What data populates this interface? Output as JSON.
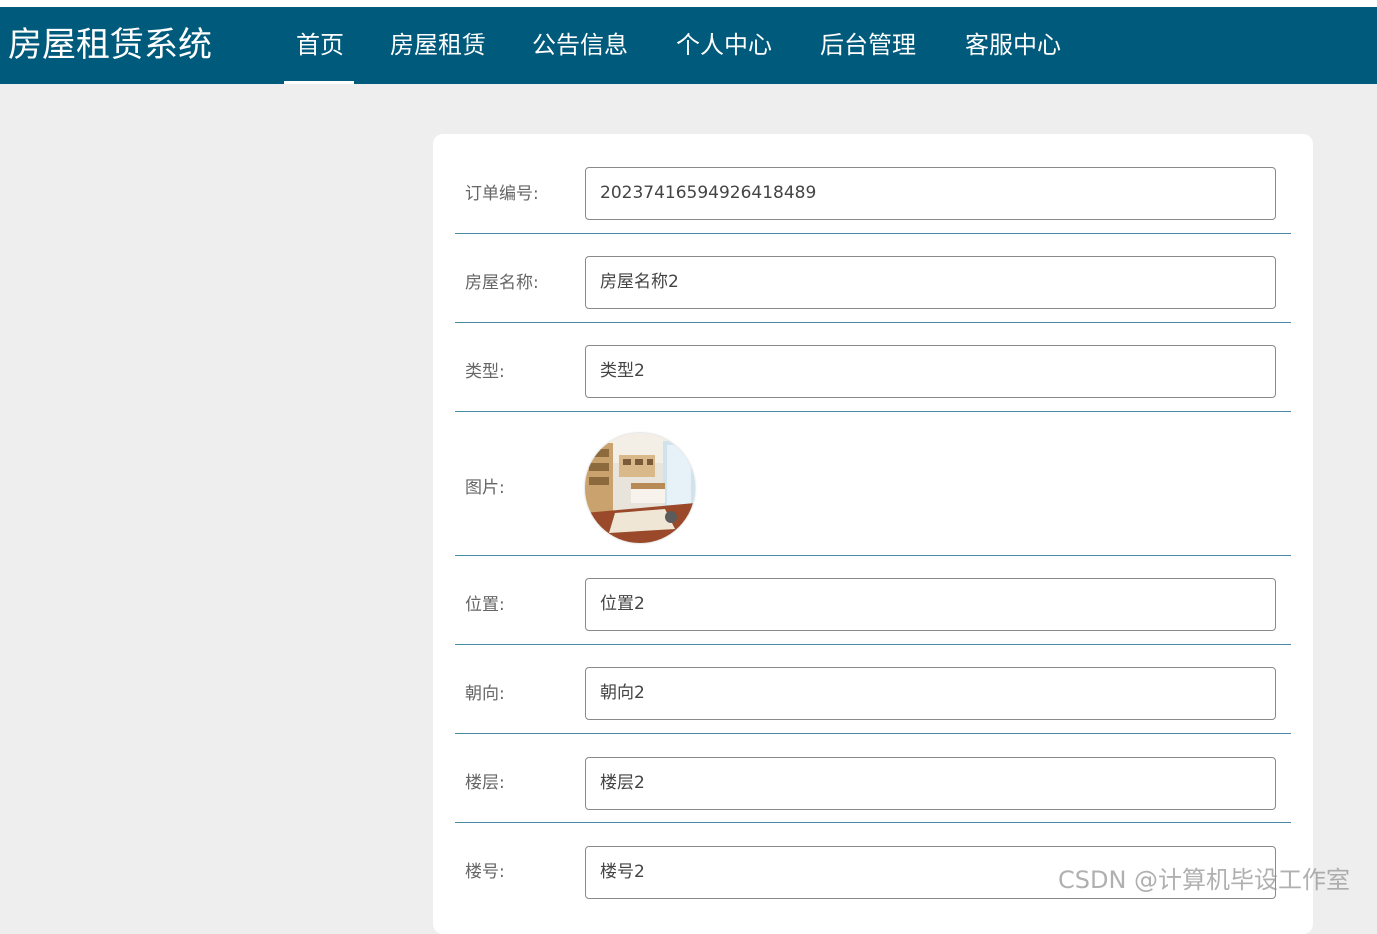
{
  "app": {
    "title": "房屋租赁系统"
  },
  "nav": {
    "items": [
      {
        "label": "首页",
        "active": true
      },
      {
        "label": "房屋租赁",
        "active": false
      },
      {
        "label": "公告信息",
        "active": false
      },
      {
        "label": "个人中心",
        "active": false
      },
      {
        "label": "后台管理",
        "active": false
      },
      {
        "label": "客服中心",
        "active": false
      }
    ]
  },
  "form": {
    "order_no": {
      "label": "订单编号:",
      "value": "20237416594926418489"
    },
    "house_name": {
      "label": "房屋名称:",
      "value": "房屋名称2"
    },
    "type": {
      "label": "类型:",
      "value": "类型2"
    },
    "image": {
      "label": "图片:"
    },
    "location": {
      "label": "位置:",
      "value": "位置2"
    },
    "orientation": {
      "label": "朝向:",
      "value": "朝向2"
    },
    "floor": {
      "label": "楼层:",
      "value": "楼层2"
    },
    "building_no": {
      "label": "楼号:",
      "value": "楼号2"
    }
  },
  "watermark": "CSDN @计算机毕设工作室",
  "colors": {
    "navbar": "#005a7c",
    "background": "#eeeeee",
    "divider": "#4a8aa4"
  }
}
